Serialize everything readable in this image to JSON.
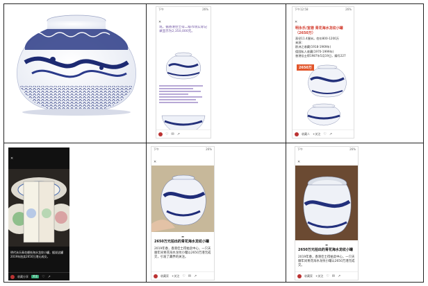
{
  "p2": {
    "status_left": "下午",
    "status_right": "26%",
    "header_text": "现，据香港佳士得二级市场实际记录显示为2,350,000元。"
  },
  "p3": {
    "status_left": "下午12:58",
    "status_right": "26%",
    "title": "明永乐/宣德 青花海水龙纹小罐",
    "title2": "（2650万）",
    "lines": [
      "直径11.4厘米。估价800-1200万",
      "来源：",
      "欧洲之收藏(1918-1969年)",
      "德国私人收藏(1970-1999年)",
      "香港佳士得1987年5月19日，编号227"
    ],
    "price_tag": "2650万",
    "user": "收藏人",
    "follow": "+关注"
  },
  "p4": {
    "status_left": "",
    "status_right": "",
    "caption": "明代永乐青花缠枝海水龙纹小罐，据说这罐2019年拍卖2650万港元成交。",
    "user": "收藏分享",
    "follow": "关注"
  },
  "p5": {
    "status_left": "下午",
    "status_right": "26%",
    "title": "2650万元拍出的青花海水龙纹小罐",
    "body": "2019年春，香港佳士得拍卖中心，一只天顺年间青花海水龙纹小罐以2650万港元成交，引发了藏界的关注。",
    "user": "收藏家",
    "follow": "+关注"
  },
  "p6": {
    "status_left": "下午",
    "status_right": "26%",
    "title": "2650万元拍出的青花海水龙纹小罐",
    "body": "2019年春，香港佳士得拍卖中心，一只天顺年间青花海水龙纹小罐以2650万港元成交。",
    "user": "收藏家",
    "follow": "+关注"
  }
}
